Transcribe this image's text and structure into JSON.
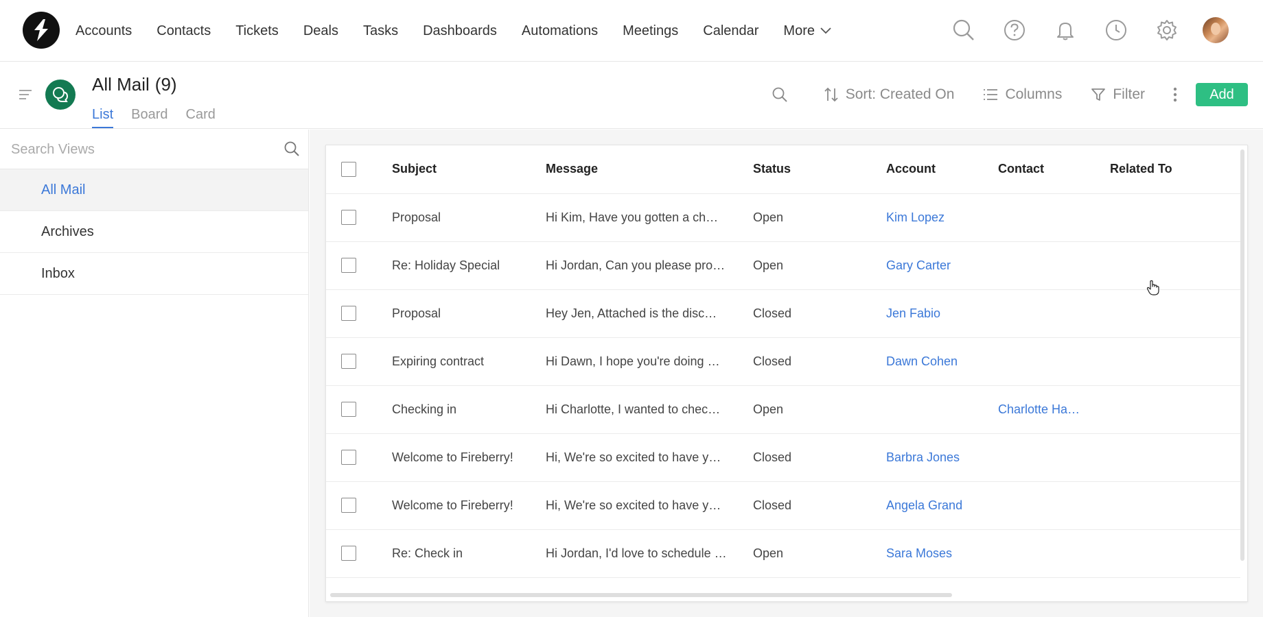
{
  "nav": {
    "items": [
      "Accounts",
      "Contacts",
      "Tickets",
      "Deals",
      "Tasks",
      "Dashboards",
      "Automations",
      "Meetings",
      "Calendar"
    ],
    "more_label": "More",
    "icons": [
      "search-icon",
      "help-icon",
      "bell-icon",
      "clock-icon",
      "gear-icon"
    ]
  },
  "header": {
    "title": "All Mail",
    "count": "(9)",
    "tabs": [
      "List",
      "Board",
      "Card"
    ],
    "active_tab": "List"
  },
  "toolbar": {
    "sort_label": "Sort: Created On",
    "columns_label": "Columns",
    "filter_label": "Filter",
    "add_label": "Add"
  },
  "sidebar": {
    "search_placeholder": "Search Views",
    "views": [
      "All Mail",
      "Archives",
      "Inbox"
    ],
    "active_view": "All Mail"
  },
  "table": {
    "columns": [
      "Subject",
      "Message",
      "Status",
      "Account",
      "Contact",
      "Related To"
    ],
    "rows": [
      {
        "subject": "Proposal",
        "message": "Hi Kim,   Have you gotten a ch…",
        "status": "Open",
        "account": "Kim Lopez",
        "contact": "",
        "related": ""
      },
      {
        "subject": "Re: Holiday Special",
        "message": "Hi Jordan, Can you please pro…",
        "status": "Open",
        "account": "Gary Carter",
        "contact": "",
        "related": ""
      },
      {
        "subject": "Proposal",
        "message": "Hey Jen,   Attached is the disc…",
        "status": "Closed",
        "account": "Jen Fabio",
        "contact": "",
        "related": ""
      },
      {
        "subject": "Expiring contract",
        "message": "Hi Dawn,   I hope you're doing …",
        "status": "Closed",
        "account": "Dawn Cohen",
        "contact": "",
        "related": ""
      },
      {
        "subject": "Checking in",
        "message": "Hi Charlotte,   I wanted to chec…",
        "status": "Open",
        "account": "",
        "contact": "Charlotte Ha…",
        "related": ""
      },
      {
        "subject": "Welcome to Fireberry!",
        "message": "Hi,   We're so excited to have y…",
        "status": "Closed",
        "account": "Barbra Jones",
        "contact": "",
        "related": ""
      },
      {
        "subject": "Welcome to Fireberry!",
        "message": "Hi,   We're so excited to have y…",
        "status": "Closed",
        "account": "Angela Grand",
        "contact": "",
        "related": ""
      },
      {
        "subject": "Re: Check in",
        "message": "Hi Jordan, I'd love to schedule …",
        "status": "Open",
        "account": "Sara Moses",
        "contact": "",
        "related": ""
      }
    ]
  },
  "colors": {
    "accent": "#3b78d8",
    "add_button": "#2ebf83",
    "module_icon": "#137a52"
  }
}
